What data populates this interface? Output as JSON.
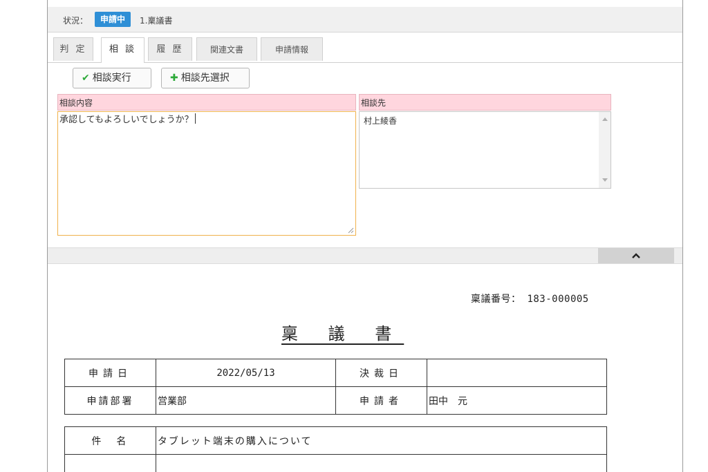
{
  "status": {
    "label": "状況：",
    "badge": "申請中",
    "document": "1.稟議書"
  },
  "tabs": [
    {
      "label": "判 定",
      "active": false
    },
    {
      "label": "相 談",
      "active": true
    },
    {
      "label": "履 歴",
      "active": false
    },
    {
      "label": "関連文書",
      "active": false
    },
    {
      "label": "申請情報",
      "active": false
    }
  ],
  "toolbar": {
    "consult_button": "相談実行",
    "consult_icon": "check-icon",
    "select_button": "相談先選択",
    "select_icon": "plus-icon"
  },
  "consult": {
    "content_header": "相談内容",
    "content_value": "承認してもよろしいでしょうか？",
    "target_header": "相談先",
    "target_items": [
      "村上綾香"
    ]
  },
  "document": {
    "number_label": "稟議番号：",
    "number_value": "183-000005",
    "title": "稟 議 書",
    "rows": [
      {
        "label1": "申請日",
        "value1": "2022/05/13",
        "label2": "決裁日",
        "value2": ""
      },
      {
        "label1": "申請部署",
        "value1": "営業部",
        "label2": "申請者",
        "value2": "田中　元"
      }
    ],
    "subject_label": "件　名",
    "subject_value": "タブレット端末の購入について"
  },
  "colors": {
    "badge": "#2f8fd6",
    "panel_header": "#ffd6de",
    "focus_border": "#f0b14a",
    "icon_green": "#2eaa3a"
  }
}
